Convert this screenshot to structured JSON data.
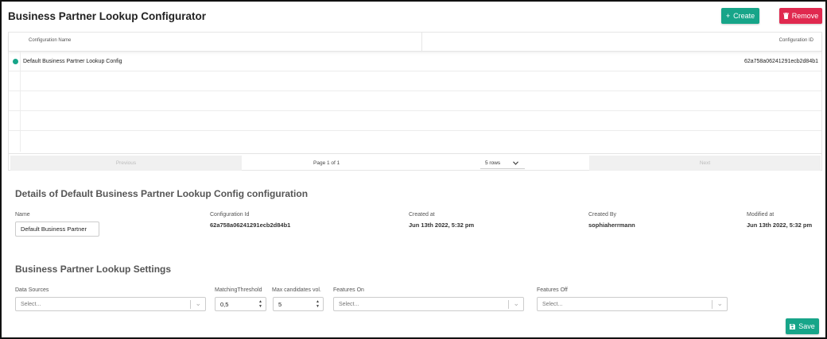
{
  "header": {
    "title": "Business Partner Lookup Configurator",
    "create_label": "Create",
    "remove_label": "Remove",
    "create_icon": "+"
  },
  "table": {
    "columns": [
      "Configuration Name",
      "Configuration ID"
    ],
    "rows": [
      {
        "name": "Default Business Partner Lookup Config",
        "id": "62a758a06241291ecb2d84b1"
      }
    ],
    "pager": {
      "previous": "Previous",
      "next": "Next",
      "page_info": "Page 1 of 1",
      "rows_option": "5 rows"
    }
  },
  "details": {
    "title": "Details of Default Business Partner Lookup Config configuration",
    "name_label": "Name",
    "name_value": "Default Business Partner",
    "config_id_label": "Configuration Id",
    "config_id_value": "62a758a06241291ecb2d84b1",
    "created_at_label": "Created at",
    "created_at_value": "Jun 13th 2022, 5:32 pm",
    "created_by_label": "Created By",
    "created_by_value": "sophiaherrmann",
    "modified_at_label": "Modified at",
    "modified_at_value": "Jun 13th 2022, 5:32 pm"
  },
  "settings": {
    "title": "Business Partner Lookup Settings",
    "data_sources_label": "Data Sources",
    "data_sources_placeholder": "Select...",
    "matching_threshold_label": "MatchingThreshold",
    "matching_threshold_value": "0,5",
    "max_candidates_label": "Max candidates vol.",
    "max_candidates_value": "5",
    "features_on_label": "Features On",
    "features_on_placeholder": "Select...",
    "features_off_label": "Features Off",
    "features_off_placeholder": "Select...",
    "save_label": "Save"
  },
  "colors": {
    "accent": "#17a589",
    "danger": "#e0294f"
  }
}
